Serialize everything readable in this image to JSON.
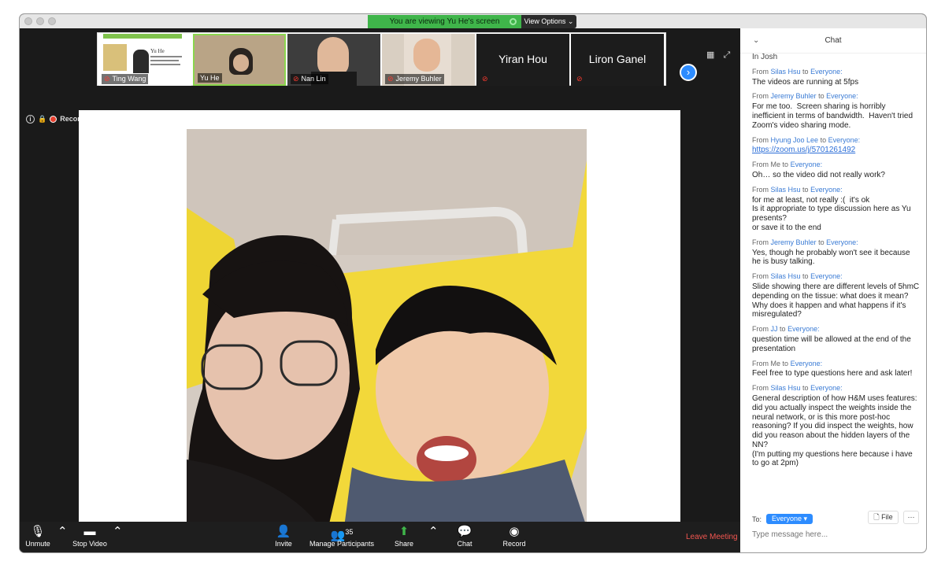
{
  "banner": {
    "text": "You are viewing Yu He's screen",
    "view_options": "View Options ⌄"
  },
  "participants": [
    {
      "name": "Ting Wang",
      "muted": true
    },
    {
      "name": "Yu He",
      "muted": false
    },
    {
      "name": "Nan Lin",
      "muted": true
    },
    {
      "name": "Jeremy Buhler",
      "muted": true
    },
    {
      "name": "Yiran Hou",
      "muted": true
    },
    {
      "name": "Liron Ganel",
      "muted": true
    }
  ],
  "slide_title": "Yu He",
  "recording_label": "Recording",
  "toolbar": {
    "unmute": "Unmute",
    "stop_video": "Stop Video",
    "invite": "Invite",
    "manage_participants": "Manage Participants",
    "participant_count": "35",
    "share": "Share",
    "chat": "Chat",
    "record": "Record",
    "leave": "Leave Meeting"
  },
  "chat": {
    "title": "Chat",
    "top_fragment": "In Josh",
    "messages": [
      {
        "from": "Silas Hsu",
        "to": "Everyone:",
        "text": "The videos are running at 5fps"
      },
      {
        "from": "Jeremy Buhler",
        "to": "Everyone:",
        "text": "For me too.  Screen sharing is horribly inefficient in terms of bandwidth.  Haven't tried Zoom's video sharing mode."
      },
      {
        "from": "Hyung Joo Lee",
        "to": "Everyone:",
        "link": "https://zoom.us/j/5701261492"
      },
      {
        "from": "Me",
        "to": "Everyone:",
        "text": "Oh… so the video did not really work?"
      },
      {
        "from": "Silas Hsu",
        "to": "Everyone:",
        "text": "for me at least, not really :(  it's ok\nIs it appropriate to type discussion here as Yu presents?\nor save it to the end"
      },
      {
        "from": "Jeremy Buhler",
        "to": "Everyone:",
        "text": "Yes, though he probably won't see it because he is busy talking."
      },
      {
        "from": "Silas Hsu",
        "to": "Everyone:",
        "text": "Slide showing there are different levels of 5hmC depending on the tissue: what does it mean? Why does it happen and what happens if it's misregulated?"
      },
      {
        "from": "JJ",
        "to": "Everyone:",
        "text": "question time will be allowed at the end of the presentation"
      },
      {
        "from": "Me",
        "to": "Everyone:",
        "text": "Feel free to type questions here and ask later!"
      },
      {
        "from": "Silas Hsu",
        "to": "Everyone:",
        "text": "General description of how H&M uses features: did you actually inspect the weights inside the neural network, or is this more post-hoc reasoning? If you did inspect the weights, how did you reason about the hidden layers of the NN?\n(I'm putting my questions here because i have to go at 2pm)"
      }
    ],
    "from_prefix": "From",
    "to_word": "to",
    "to_label": "To:",
    "recipient": "Everyone ▾",
    "file_label": "File",
    "more_label": "···",
    "input_placeholder": "Type message here..."
  }
}
